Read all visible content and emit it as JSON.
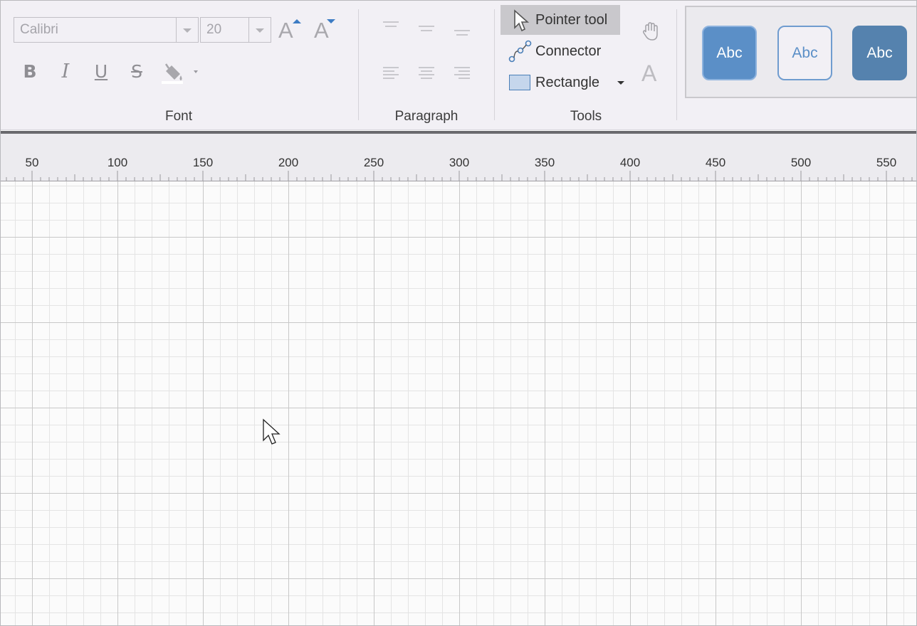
{
  "ribbon": {
    "font_group": {
      "label": "Font",
      "font_name": "Calibri",
      "font_size": "20",
      "grow_font_glyph": "A",
      "shrink_font_glyph": "A",
      "bold": "B",
      "italic": "I",
      "underline": "U",
      "strikethrough": "S",
      "fill_icon": "paint-bucket-icon"
    },
    "paragraph_group": {
      "label": "Paragraph",
      "buttons": [
        "align-top-left",
        "align-top-center",
        "align-top-right",
        "align-left",
        "align-center",
        "align-right"
      ]
    },
    "tools_group": {
      "label": "Tools",
      "pointer_tool": "Pointer tool",
      "connector": "Connector",
      "rectangle": "Rectangle",
      "pan_icon": "hand-icon",
      "text_tool_glyph": "A"
    },
    "shape_styles": [
      {
        "label": "Abc",
        "fill": "#5b8fc7",
        "border": "#8eb3de",
        "text_color": "#ffffff"
      },
      {
        "label": "Abc",
        "fill": "#f2f0f5",
        "border": "#6f9ccf",
        "text_color": "#5b8fc7"
      },
      {
        "label": "Abc",
        "fill": "#5582ae",
        "border": "#5582ae",
        "text_color": "#ffffff"
      }
    ]
  },
  "ruler": {
    "labels": [
      "50",
      "100",
      "150",
      "200",
      "250",
      "300",
      "350",
      "400",
      "450",
      "500",
      "550"
    ]
  },
  "colors": {
    "accent": "#3d7cc4",
    "ribbon_bg": "#f2f0f5",
    "active_tool_bg": "#c9c8cc",
    "grid_major": "#c8c8c8",
    "grid_minor": "#e4e4e4"
  }
}
